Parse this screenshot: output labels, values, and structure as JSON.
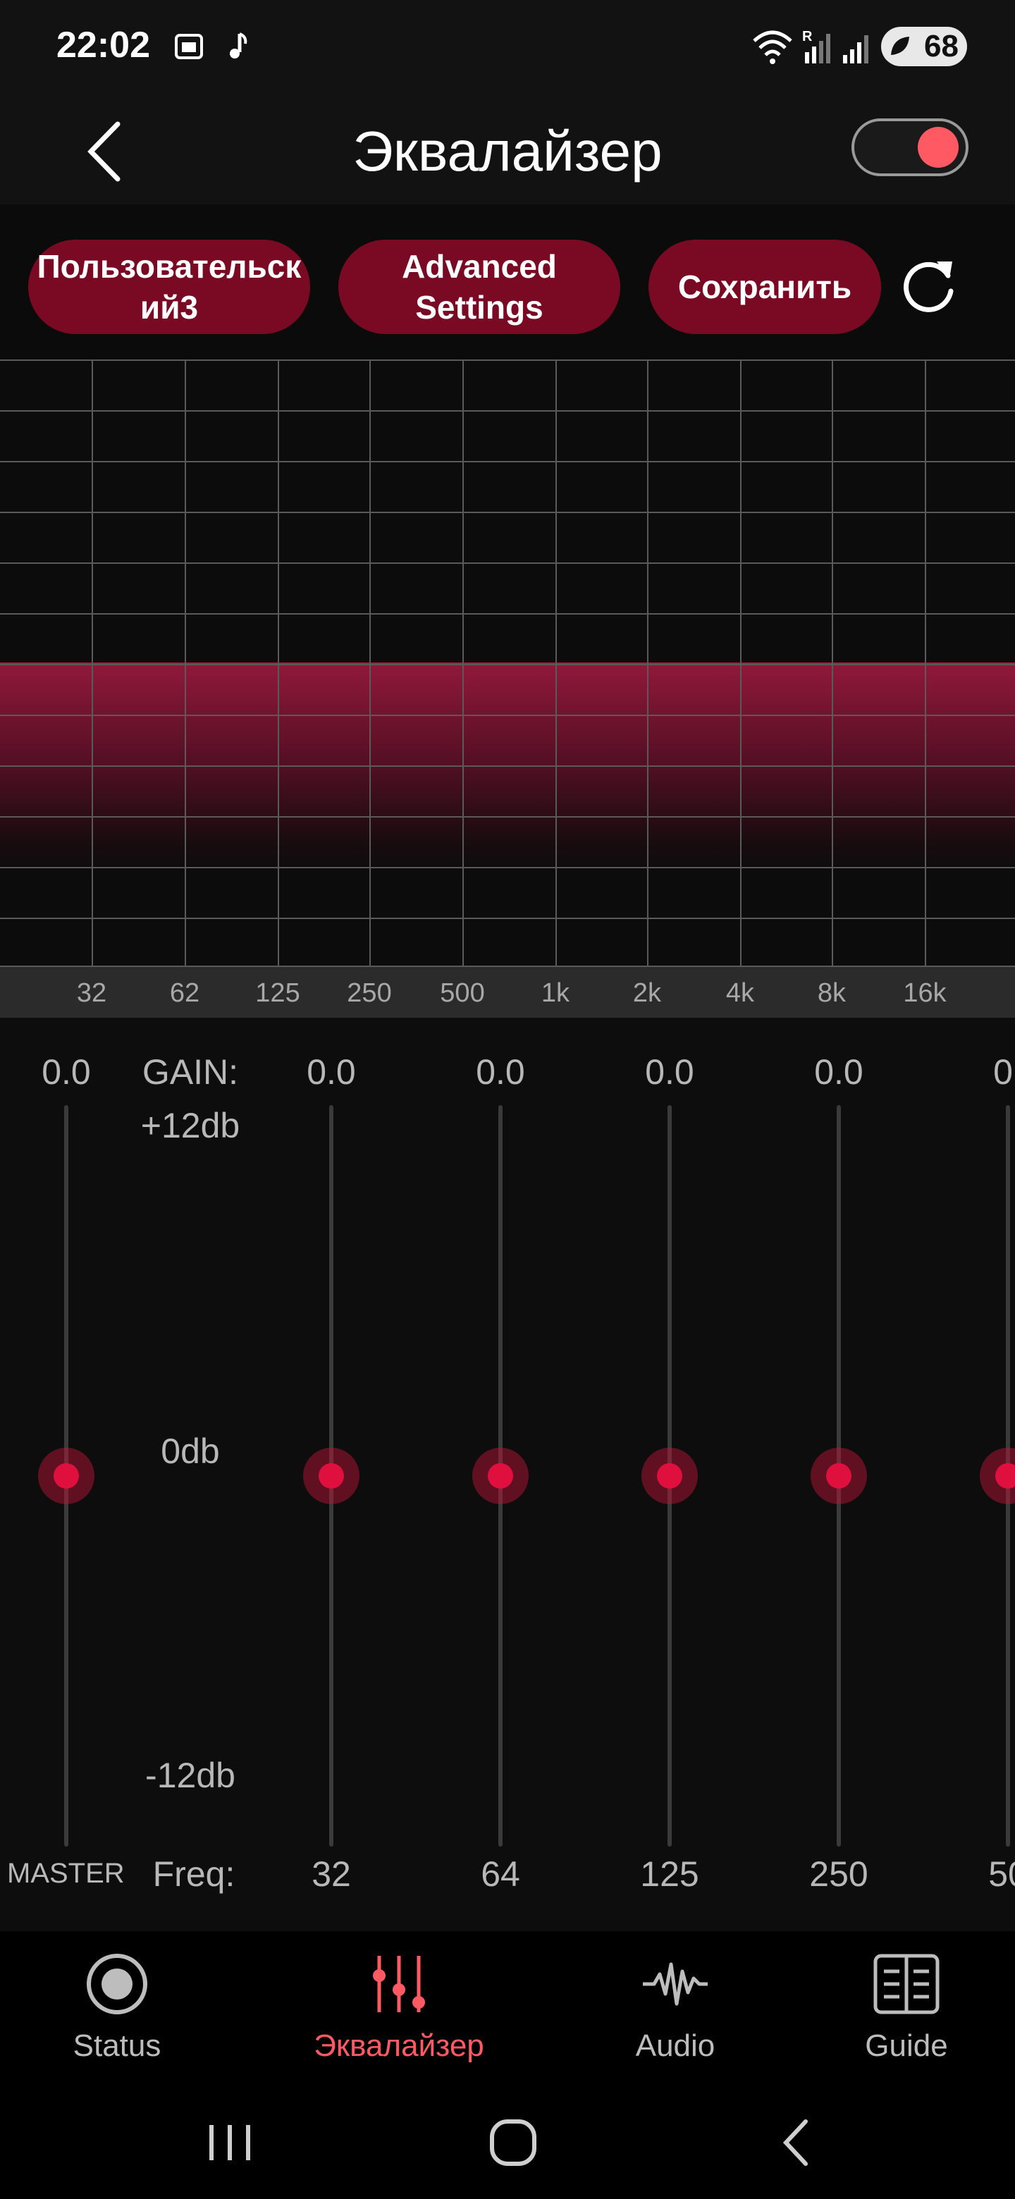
{
  "status_bar": {
    "time": "22:02",
    "battery": "68",
    "icons": [
      "gallery-icon",
      "music-note-icon",
      "wifi-icon",
      "signal-roaming-icon",
      "signal-icon",
      "battery-icon"
    ]
  },
  "header": {
    "title": "Эквалайзер",
    "back_icon": "chevron-left-icon",
    "toggle_on": true,
    "accent_color": "#ff5a63"
  },
  "presets": {
    "preset_label": "Пользовательск\nий3",
    "advanced_label": "Advanced\nSettings",
    "save_label": "Сохранить",
    "reset_icon": "refresh-icon",
    "pill_color": "#7a0a24"
  },
  "graph": {
    "freq_labels": [
      "32",
      "62",
      "125",
      "250",
      "500",
      "1k",
      "2k",
      "4k",
      "8k",
      "16k"
    ],
    "curve_color": "#c0143c"
  },
  "sliders": {
    "gain_label": "GAIN:",
    "max_label": "+12db",
    "mid_label": "0db",
    "min_label": "-12db",
    "master_label": "MASTER",
    "freq_label": "Freq:",
    "bands": [
      {
        "id": "master",
        "value": "0.0",
        "freq": ""
      },
      {
        "id": "32",
        "value": "0.0",
        "freq": "32"
      },
      {
        "id": "64",
        "value": "0.0",
        "freq": "64"
      },
      {
        "id": "125",
        "value": "0.0",
        "freq": "125"
      },
      {
        "id": "250",
        "value": "0.0",
        "freq": "250"
      },
      {
        "id": "500",
        "value": "0.",
        "freq": "50"
      }
    ]
  },
  "bottom_nav": {
    "items": [
      {
        "label": "Status",
        "icon": "status-icon",
        "active": false
      },
      {
        "label": "Эквалайзер",
        "icon": "equalizer-icon",
        "active": true
      },
      {
        "label": "Audio",
        "icon": "audio-wave-icon",
        "active": false
      },
      {
        "label": "Guide",
        "icon": "guide-book-icon",
        "active": false
      }
    ]
  },
  "system_nav": {
    "icons": [
      "recent-apps-icon",
      "home-icon",
      "back-icon"
    ]
  }
}
